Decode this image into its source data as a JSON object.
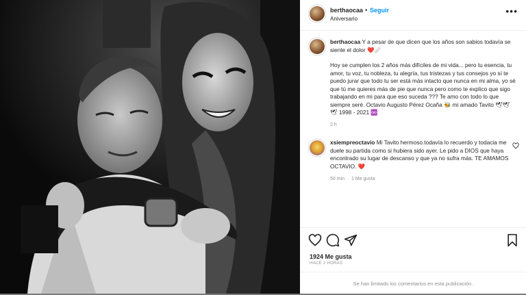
{
  "post": {
    "username": "berthaocaa",
    "dot": "•",
    "follow_label": "Seguir",
    "subtitle": "Aniversario",
    "more_icon": "more-horizontal-icon"
  },
  "caption": {
    "username": "berthaocaa",
    "line1": "Y a pesar de que dicen que los años son sabios todavía se siente el dolor ❤️🩹",
    "paragraph": "Hoy se cumplen los 2 años más difíciles de mi vida... pero tu esencia, tu amor, tu voz, tu nobleza, tu alegría, tus tristezas y tus consejos yo sí te puedo jurar que todo tu ser está más intacto que nunca en mi alma, yo sé que tú me quieres más de pie que nunca pero como te explico que sigo trabajando en mi para que eso suceda ??? Te amo con todo lo que siempre seré. Octavio Augusto Pérez Ocaña 🐝 mi amado Tavito 🕊🕊🕊 1998 - 2021 ♾️",
    "time": "2 h"
  },
  "comment": {
    "username": "xsiempreoctavio",
    "text": "Mi Tavito hermoso.todavía lo recuerdo y todacia me duele su partida como si hubiera sido ayer. Le pido a DIOS que haya encontrado su lugar de descanso y que ya no sufra más. TE AMAMOS OCTAVIO. ❤️",
    "time": "50 min",
    "likes": "1 Me gusta"
  },
  "actions": {
    "likes": "1924 Me gusta",
    "posted": "HACE 2 HORAS",
    "limited": "Se han limitado los comentarios en esta publicación."
  },
  "colors": {
    "accent": "#0095f6",
    "heart": "#ed4956",
    "muted": "#8e8e8e",
    "backdrop": "#7a7a7a"
  }
}
